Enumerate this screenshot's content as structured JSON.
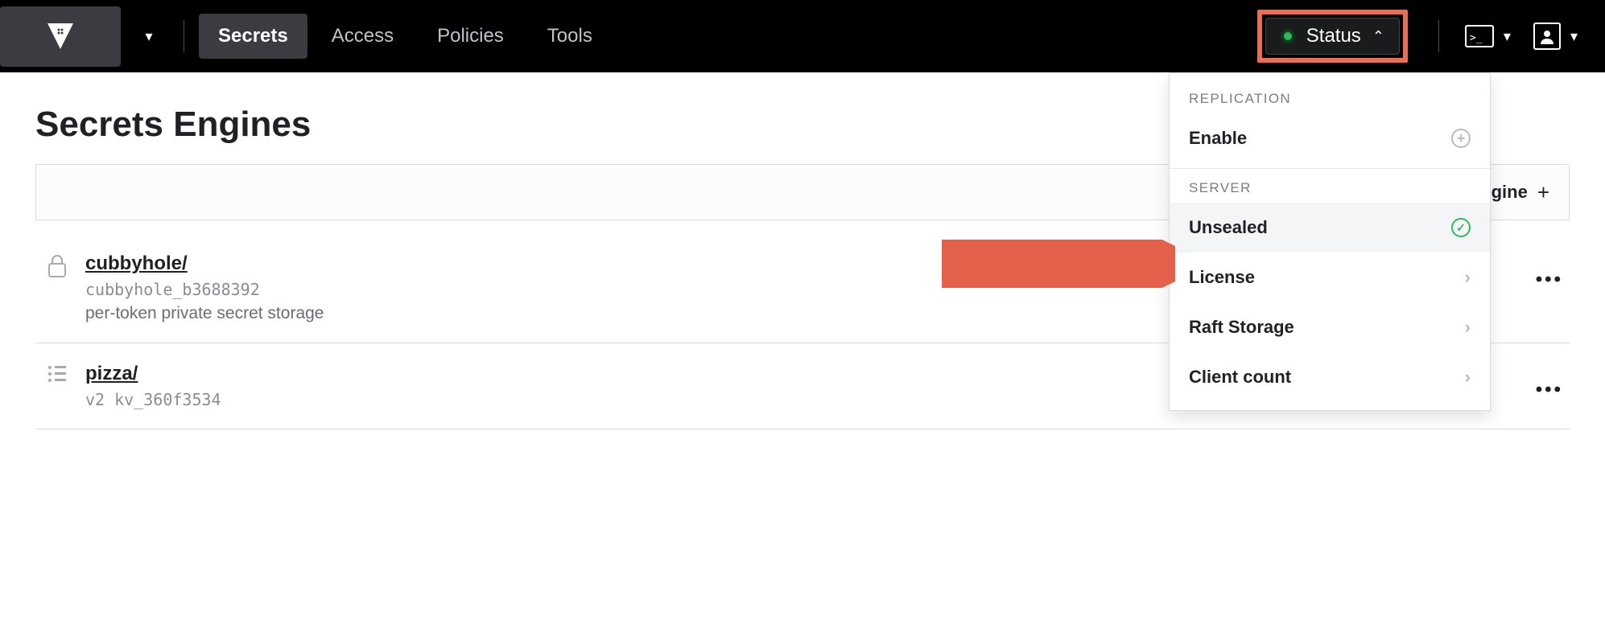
{
  "nav": {
    "links": [
      "Secrets",
      "Access",
      "Policies",
      "Tools"
    ],
    "active_index": 0,
    "status_label": "Status"
  },
  "dropdown": {
    "sections": [
      {
        "label": "REPLICATION",
        "items": [
          {
            "label": "Enable",
            "right": "plus",
            "highlight": false
          }
        ]
      },
      {
        "label": "SERVER",
        "items": [
          {
            "label": "Unsealed",
            "right": "check",
            "highlight": true
          },
          {
            "label": "License",
            "right": "chevron",
            "highlight": false
          },
          {
            "label": "Raft Storage",
            "right": "chevron",
            "highlight": false
          },
          {
            "label": "Client count",
            "right": "chevron",
            "highlight": false
          }
        ]
      }
    ]
  },
  "page": {
    "title": "Secrets Engines",
    "enable_new_label": "Enable new engine"
  },
  "engines": [
    {
      "name": "cubbyhole/",
      "meta": "cubbyhole_b3688392",
      "desc": "per-token private secret storage",
      "icon": "lock"
    },
    {
      "name": "pizza/",
      "meta": "v2 kv_360f3534",
      "desc": "",
      "icon": "list"
    }
  ]
}
